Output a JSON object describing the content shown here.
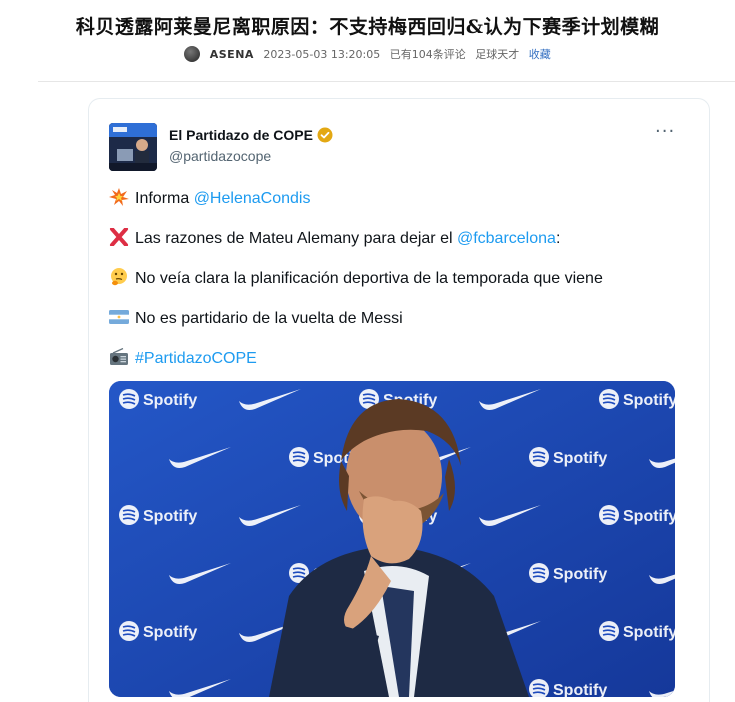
{
  "article": {
    "title": "科贝透露阿莱曼尼离职原因：不支持梅西回归&认为下赛季计划模糊",
    "author": "ASENA",
    "datetime": "2023-05-03 13:20:05",
    "comments": "已有104条评论",
    "site": "足球天才",
    "favorite": "收藏"
  },
  "tweet": {
    "name": "El Partidazo de COPE",
    "handle": "@partidazocope",
    "lines": [
      {
        "emoji": "collision-icon",
        "text": "Informa ",
        "link": "@HelenaCondis",
        "after": ""
      },
      {
        "emoji": "cross-mark-icon",
        "text": "Las razones de Mateu Alemany para dejar el ",
        "link": "@fcbarcelona",
        "after": ":"
      },
      {
        "emoji": "thinking-face-icon",
        "text": "No veía clara la planificación deportiva de la temporada que viene",
        "link": "",
        "after": ""
      },
      {
        "emoji": "argentina-flag-icon",
        "text": "No es partidario de la vuelta de Messi",
        "link": "",
        "after": ""
      },
      {
        "emoji": "radio-icon",
        "text": "",
        "link": "#PartidazoCOPE",
        "after": ""
      }
    ],
    "photo_texts": {
      "brand": "Spotify"
    }
  },
  "colors": {
    "link": "#1d9bf0",
    "verified": "#e3a813",
    "backdrop": "#1b46b8"
  }
}
